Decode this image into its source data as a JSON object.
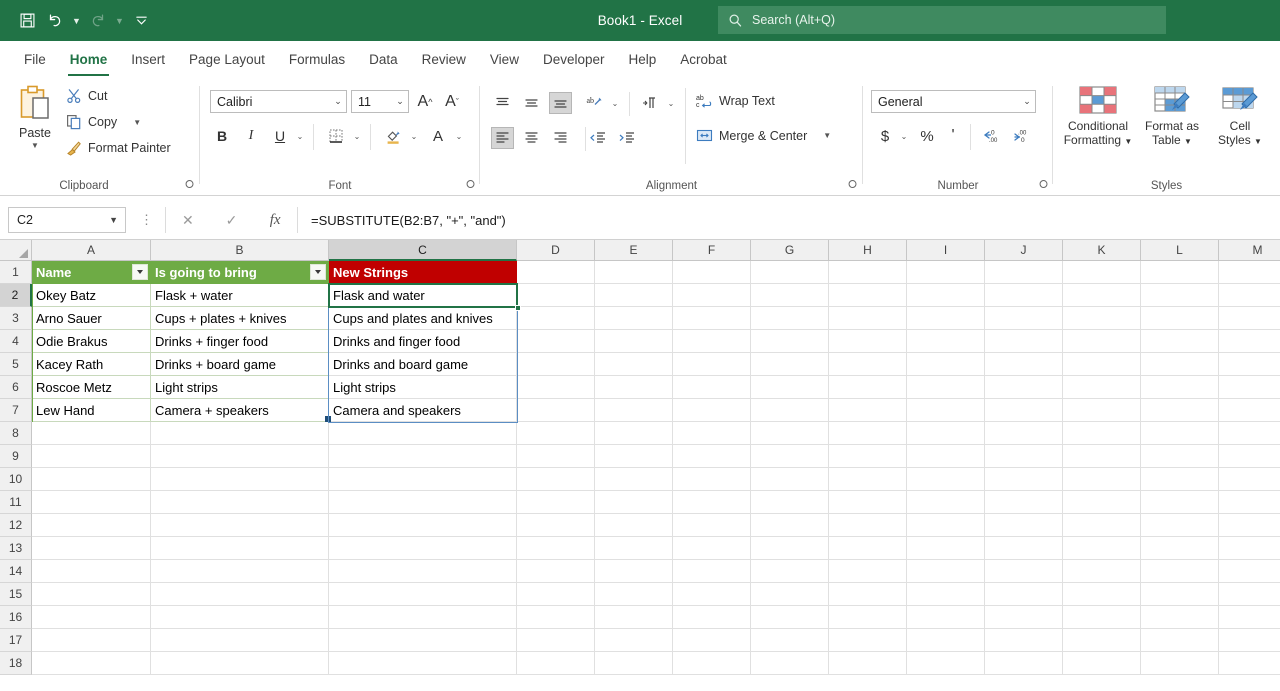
{
  "window": {
    "title": "Book1  -  Excel",
    "qat": [
      {
        "name": "save-button",
        "icon": "save-icon"
      },
      {
        "name": "undo-button",
        "icon": "undo-icon"
      },
      {
        "name": "redo-button",
        "icon": "redo-icon"
      },
      {
        "name": "customize-qat-button",
        "icon": "chevron-down-icon"
      }
    ]
  },
  "search": {
    "placeholder": "Search (Alt+Q)",
    "icon": "search-icon"
  },
  "tabs": [
    {
      "label": "File",
      "active": false
    },
    {
      "label": "Home",
      "active": true
    },
    {
      "label": "Insert",
      "active": false
    },
    {
      "label": "Page Layout",
      "active": false
    },
    {
      "label": "Formulas",
      "active": false
    },
    {
      "label": "Data",
      "active": false
    },
    {
      "label": "Review",
      "active": false
    },
    {
      "label": "View",
      "active": false
    },
    {
      "label": "Developer",
      "active": false
    },
    {
      "label": "Help",
      "active": false
    },
    {
      "label": "Acrobat",
      "active": false
    }
  ],
  "ribbon": {
    "clipboard": {
      "group_label": "Clipboard",
      "paste_label": "Paste",
      "cut_label": "Cut",
      "copy_label": "Copy",
      "format_painter_label": "Format Painter"
    },
    "font": {
      "group_label": "Font",
      "font_family_value": "Calibri",
      "font_size_value": "11",
      "bold_label": "B",
      "italic_label": "I",
      "underline_label": "U",
      "font_color_label": "A"
    },
    "alignment": {
      "group_label": "Alignment",
      "wrap_text_label": "Wrap Text",
      "merge_center_label": "Merge & Center"
    },
    "number": {
      "group_label": "Number",
      "format_value": "General",
      "currency_label": "$",
      "percent_label": "%",
      "comma_label": "'"
    },
    "styles": {
      "group_label": "Styles",
      "conditional_formatting_label": "Conditional\nFormatting",
      "conditional_formatting_line1": "Conditional",
      "conditional_formatting_line2": "Formatting",
      "format_as_table_line1": "Format as",
      "format_as_table_line2": "Table",
      "cell_styles_line1": "Cell",
      "cell_styles_line2": "Styles"
    }
  },
  "formula_bar": {
    "name_box_value": "C2",
    "cancel_icon": "cancel-icon",
    "enter_icon": "checkmark-icon",
    "function_icon": "fx-icon",
    "formula_value": "=SUBSTITUTE(B2:B7, \"+\", \"and\")"
  },
  "grid": {
    "active_cell": "C2",
    "active_column": "C",
    "active_row": 2,
    "columns": [
      "A",
      "B",
      "C",
      "D",
      "E",
      "F",
      "G",
      "H",
      "I",
      "J",
      "K",
      "L",
      "M"
    ],
    "rows": [
      1,
      2,
      3,
      4,
      5,
      6,
      7,
      8,
      9,
      10,
      11,
      12,
      13,
      14,
      15,
      16,
      17,
      18
    ],
    "headers": {
      "A": "Name",
      "B": "Is going to bring",
      "C": "New Strings"
    },
    "data": [
      {
        "row": 2,
        "A": "Okey Batz",
        "B": "Flask + water",
        "C": "Flask and water"
      },
      {
        "row": 3,
        "A": "Arno Sauer",
        "B": "Cups + plates + knives",
        "C": " Cups and plates and knives"
      },
      {
        "row": 4,
        "A": "Odie Brakus",
        "B": "Drinks + finger food",
        "C": "Drinks and finger food"
      },
      {
        "row": 5,
        "A": "Kacey Rath",
        "B": "Drinks + board game",
        "C": "Drinks and board game"
      },
      {
        "row": 6,
        "A": "Roscoe Metz",
        "B": "Light strips",
        "C": "Light strips"
      },
      {
        "row": 7,
        "A": "Lew Hand",
        "B": "Camera + speakers",
        "C": "Camera and speakers"
      }
    ]
  },
  "colors": {
    "title_bar": "#217346",
    "table_header_green": "#6eab45",
    "table_header_red": "#c00000",
    "active_cell_border": "#217346",
    "spill_border": "#5b8ec4"
  }
}
